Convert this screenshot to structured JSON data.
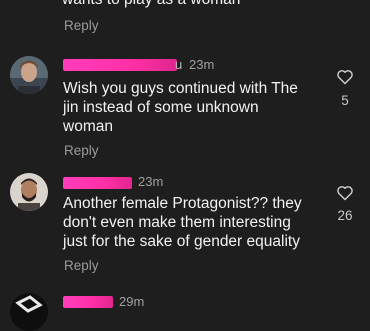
{
  "comments": [
    {
      "text": "wants to play as a woman",
      "reply_label": "Reply"
    },
    {
      "username_tail": "u",
      "time": "23m",
      "text_lines": [
        "Wish you guys continued with The",
        "jin instead of some unknown",
        "woman"
      ],
      "reply_label": "Reply",
      "likes": "5"
    },
    {
      "time": "23m",
      "text_lines": [
        "Another female Protagonist?? they",
        "don't even make them interesting",
        "just for the sake of gender equality"
      ],
      "reply_label": "Reply",
      "likes": "26"
    },
    {
      "time": "29m"
    }
  ],
  "icons": {
    "like": "heart-outline-icon",
    "avatar": "user-avatar"
  },
  "colors": {
    "background": "#1e1e1e",
    "redaction": "#ff2fa6",
    "muted_text": "#9a9a9a"
  }
}
